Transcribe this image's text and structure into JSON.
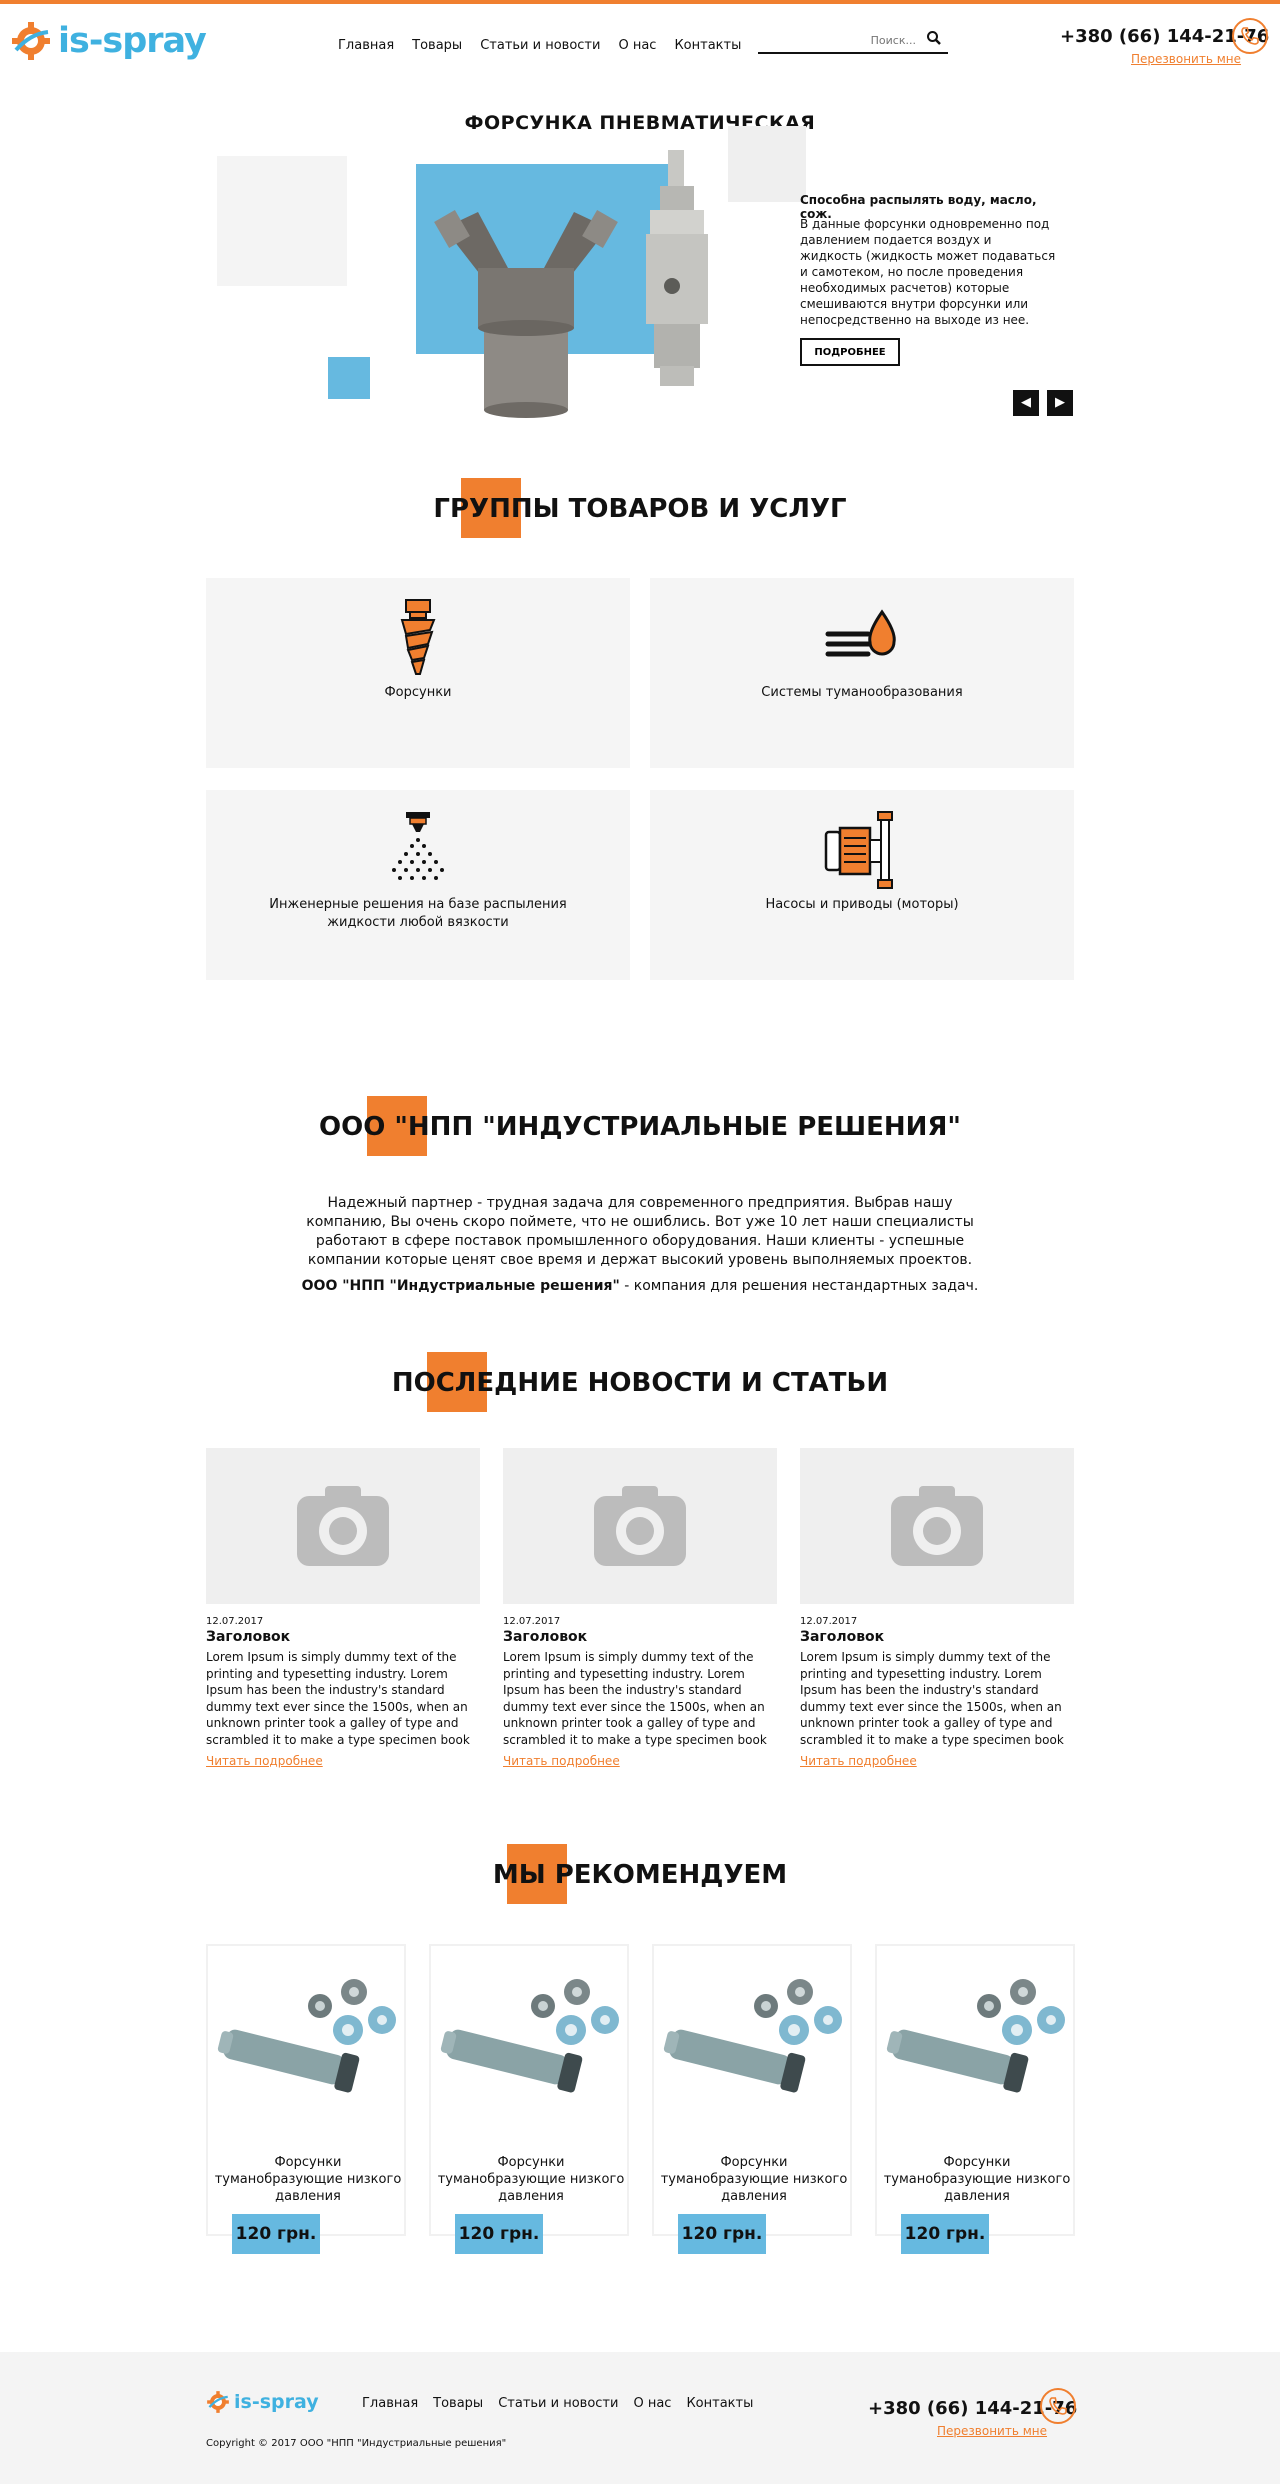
{
  "brand": {
    "name": "is-spray",
    "accent": "#f07f2f",
    "blue": "#3fb1e0"
  },
  "header": {
    "nav": [
      "Главная",
      "Товары",
      "Статьи и новости",
      "О нас",
      "Контакты"
    ],
    "search_placeholder": "Поиск...",
    "phone": "+380 (66) 144-21-76",
    "callback": "Перезвонить мне"
  },
  "hero": {
    "title": "ФОРСУНКА ПНЕВМАТИЧЕСКАЯ",
    "subtitle": "Способна распылять воду, масло, сож.",
    "text": "В данные форсунки одновременно под давлением подается воздух и жидкость (жидкость может подаваться и самотеком, но после проведения необходимых расчетов) которые смешиваются внутри форсунки или непосредственно на выходе из нее.",
    "button": "ПОДРОБНЕЕ"
  },
  "services": {
    "title": "ГРУППЫ ТОВАРОВ И УСЛУГ",
    "items": [
      {
        "label": "Форсунки",
        "icon": "nozzle-icon"
      },
      {
        "label": "Системы туманообразования",
        "icon": "fog-icon"
      },
      {
        "label": "Инженерные решения на базе распыления жидкости любой вязкости",
        "icon": "spray-icon"
      },
      {
        "label": "Насосы и приводы (моторы)",
        "icon": "pump-icon"
      }
    ]
  },
  "about": {
    "title": "ООО \"НПП \"ИНДУСТРИАЛЬНЫЕ РЕШЕНИЯ\"",
    "text": "Надежный партнер - трудная задача для современного предприятия. Выбрав нашу компанию, Вы очень скоро поймете, что не ошиблись. Вот уже 10 лет наши специалисты работают в сфере поставок промышленного оборудования. Наши клиенты - успешные компании которые ценят свое время и держат высокий уровень выполняемых проектов.",
    "tagline_bold": "ООО \"НПП \"Индустриальные решения\"",
    "tagline_rest": " - компания для решения нестандартных задач."
  },
  "news": {
    "title": "ПОСЛЕДНИЕ НОВОСТИ И СТАТЬИ",
    "items": [
      {
        "date": "12.07.2017",
        "title": "Заголовок",
        "text": "Lorem Ipsum is simply dummy text of the printing and typesetting industry. Lorem Ipsum has been the industry's standard dummy text ever since the 1500s, when an unknown printer took a galley of type and scrambled it to make a type specimen book",
        "link": "Читать подробнее"
      },
      {
        "date": "12.07.2017",
        "title": "Заголовок",
        "text": "Lorem Ipsum is simply dummy text of the printing and typesetting industry. Lorem Ipsum has been the industry's standard dummy text ever since the 1500s, when an unknown printer took a galley of type and scrambled it to make a type specimen book",
        "link": "Читать подробнее"
      },
      {
        "date": "12.07.2017",
        "title": "Заголовок",
        "text": "Lorem Ipsum is simply dummy text of the printing and typesetting industry. Lorem Ipsum has been the industry's standard dummy text ever since the 1500s, when an unknown printer took a galley of type and scrambled it to make a type specimen book",
        "link": "Читать подробнее"
      }
    ]
  },
  "recommend": {
    "title": "МЫ РЕКОМЕНДУЕМ",
    "items": [
      {
        "name": "Форсунки туманобразующие низкого давления",
        "price": "120 грн."
      },
      {
        "name": "Форсунки туманобразующие низкого давления",
        "price": "120 грн."
      },
      {
        "name": "Форсунки туманобразующие низкого давления",
        "price": "120 грн."
      },
      {
        "name": "Форсунки туманобразующие низкого давления",
        "price": "120 грн."
      }
    ]
  },
  "footer": {
    "nav": [
      "Главная",
      "Товары",
      "Статьи и новости",
      "О нас",
      "Контакты"
    ],
    "copyright": "Copyright © 2017 ООО \"НПП \"Индустриальные решения\"",
    "phone": "+380 (66) 144-21-76",
    "callback": "Перезвонить мне"
  }
}
